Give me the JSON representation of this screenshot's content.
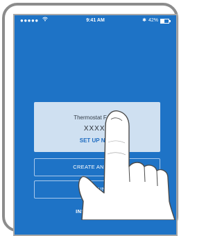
{
  "status_bar": {
    "signal": "●●●●●",
    "wifi_icon": "wifi-icon",
    "time": "9:41 AM",
    "bluetooth": "✱",
    "battery_percent": "42%",
    "battery_level": 0.42
  },
  "card": {
    "title": "Thermostat Found:",
    "device_code": "XXXXX",
    "action_label": "SET UP NOW"
  },
  "buttons": {
    "create_account": "CREATE AN ACCO",
    "login": "LOGIN"
  },
  "install_link": "INSTALL A DEVI",
  "colors": {
    "screen_bg": "#1e73c6",
    "card_bg": "#cfe0f1",
    "link": "#1e6bc0",
    "frame": "#8c8c8c"
  },
  "overlay": {
    "icon": "pointing-hand-icon"
  }
}
